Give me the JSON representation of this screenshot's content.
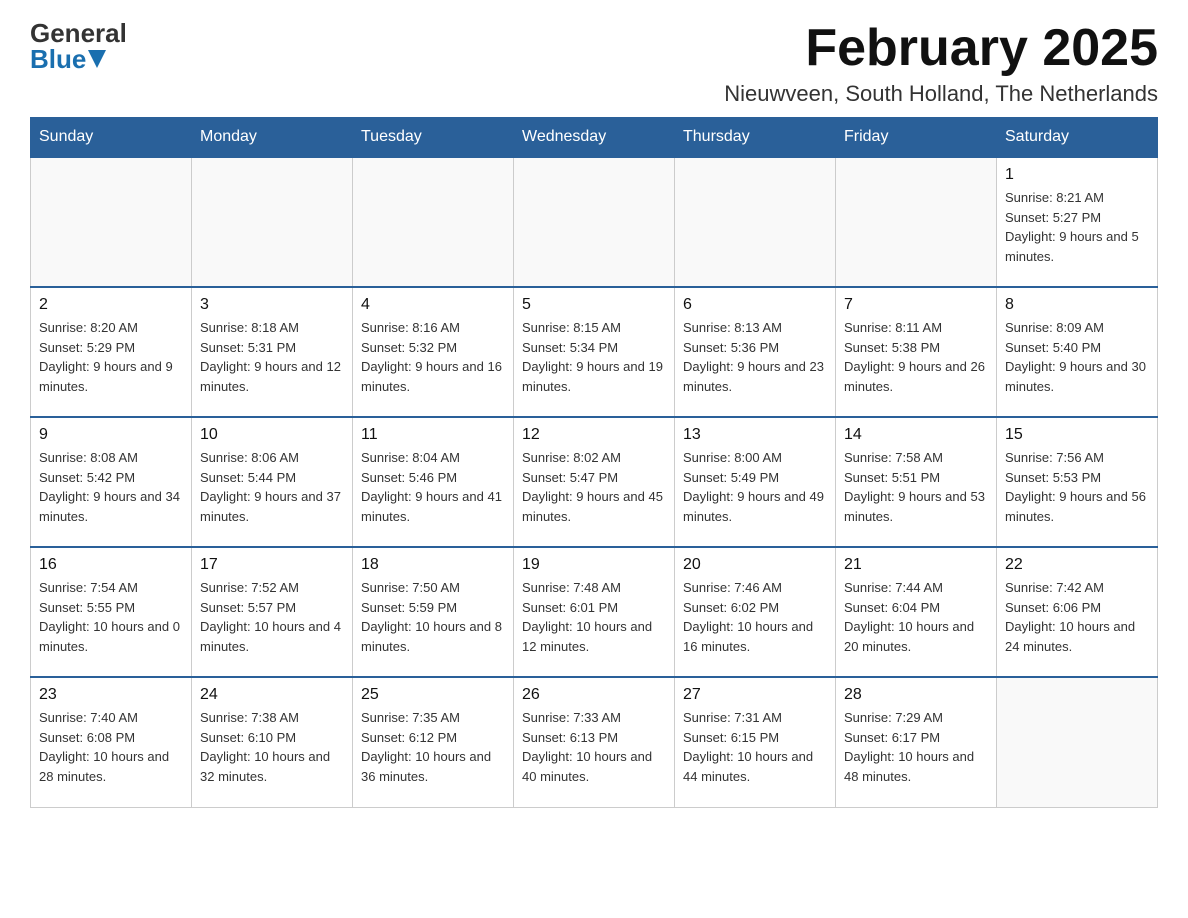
{
  "header": {
    "logo": {
      "general": "General",
      "blue": "Blue"
    },
    "title": "February 2025",
    "location": "Nieuwveen, South Holland, The Netherlands"
  },
  "days_of_week": [
    "Sunday",
    "Monday",
    "Tuesday",
    "Wednesday",
    "Thursday",
    "Friday",
    "Saturday"
  ],
  "weeks": [
    {
      "days": [
        {
          "date": "",
          "info": ""
        },
        {
          "date": "",
          "info": ""
        },
        {
          "date": "",
          "info": ""
        },
        {
          "date": "",
          "info": ""
        },
        {
          "date": "",
          "info": ""
        },
        {
          "date": "",
          "info": ""
        },
        {
          "date": "1",
          "info": "Sunrise: 8:21 AM\nSunset: 5:27 PM\nDaylight: 9 hours and 5 minutes."
        }
      ]
    },
    {
      "days": [
        {
          "date": "2",
          "info": "Sunrise: 8:20 AM\nSunset: 5:29 PM\nDaylight: 9 hours and 9 minutes."
        },
        {
          "date": "3",
          "info": "Sunrise: 8:18 AM\nSunset: 5:31 PM\nDaylight: 9 hours and 12 minutes."
        },
        {
          "date": "4",
          "info": "Sunrise: 8:16 AM\nSunset: 5:32 PM\nDaylight: 9 hours and 16 minutes."
        },
        {
          "date": "5",
          "info": "Sunrise: 8:15 AM\nSunset: 5:34 PM\nDaylight: 9 hours and 19 minutes."
        },
        {
          "date": "6",
          "info": "Sunrise: 8:13 AM\nSunset: 5:36 PM\nDaylight: 9 hours and 23 minutes."
        },
        {
          "date": "7",
          "info": "Sunrise: 8:11 AM\nSunset: 5:38 PM\nDaylight: 9 hours and 26 minutes."
        },
        {
          "date": "8",
          "info": "Sunrise: 8:09 AM\nSunset: 5:40 PM\nDaylight: 9 hours and 30 minutes."
        }
      ]
    },
    {
      "days": [
        {
          "date": "9",
          "info": "Sunrise: 8:08 AM\nSunset: 5:42 PM\nDaylight: 9 hours and 34 minutes."
        },
        {
          "date": "10",
          "info": "Sunrise: 8:06 AM\nSunset: 5:44 PM\nDaylight: 9 hours and 37 minutes."
        },
        {
          "date": "11",
          "info": "Sunrise: 8:04 AM\nSunset: 5:46 PM\nDaylight: 9 hours and 41 minutes."
        },
        {
          "date": "12",
          "info": "Sunrise: 8:02 AM\nSunset: 5:47 PM\nDaylight: 9 hours and 45 minutes."
        },
        {
          "date": "13",
          "info": "Sunrise: 8:00 AM\nSunset: 5:49 PM\nDaylight: 9 hours and 49 minutes."
        },
        {
          "date": "14",
          "info": "Sunrise: 7:58 AM\nSunset: 5:51 PM\nDaylight: 9 hours and 53 minutes."
        },
        {
          "date": "15",
          "info": "Sunrise: 7:56 AM\nSunset: 5:53 PM\nDaylight: 9 hours and 56 minutes."
        }
      ]
    },
    {
      "days": [
        {
          "date": "16",
          "info": "Sunrise: 7:54 AM\nSunset: 5:55 PM\nDaylight: 10 hours and 0 minutes."
        },
        {
          "date": "17",
          "info": "Sunrise: 7:52 AM\nSunset: 5:57 PM\nDaylight: 10 hours and 4 minutes."
        },
        {
          "date": "18",
          "info": "Sunrise: 7:50 AM\nSunset: 5:59 PM\nDaylight: 10 hours and 8 minutes."
        },
        {
          "date": "19",
          "info": "Sunrise: 7:48 AM\nSunset: 6:01 PM\nDaylight: 10 hours and 12 minutes."
        },
        {
          "date": "20",
          "info": "Sunrise: 7:46 AM\nSunset: 6:02 PM\nDaylight: 10 hours and 16 minutes."
        },
        {
          "date": "21",
          "info": "Sunrise: 7:44 AM\nSunset: 6:04 PM\nDaylight: 10 hours and 20 minutes."
        },
        {
          "date": "22",
          "info": "Sunrise: 7:42 AM\nSunset: 6:06 PM\nDaylight: 10 hours and 24 minutes."
        }
      ]
    },
    {
      "days": [
        {
          "date": "23",
          "info": "Sunrise: 7:40 AM\nSunset: 6:08 PM\nDaylight: 10 hours and 28 minutes."
        },
        {
          "date": "24",
          "info": "Sunrise: 7:38 AM\nSunset: 6:10 PM\nDaylight: 10 hours and 32 minutes."
        },
        {
          "date": "25",
          "info": "Sunrise: 7:35 AM\nSunset: 6:12 PM\nDaylight: 10 hours and 36 minutes."
        },
        {
          "date": "26",
          "info": "Sunrise: 7:33 AM\nSunset: 6:13 PM\nDaylight: 10 hours and 40 minutes."
        },
        {
          "date": "27",
          "info": "Sunrise: 7:31 AM\nSunset: 6:15 PM\nDaylight: 10 hours and 44 minutes."
        },
        {
          "date": "28",
          "info": "Sunrise: 7:29 AM\nSunset: 6:17 PM\nDaylight: 10 hours and 48 minutes."
        },
        {
          "date": "",
          "info": ""
        }
      ]
    }
  ]
}
